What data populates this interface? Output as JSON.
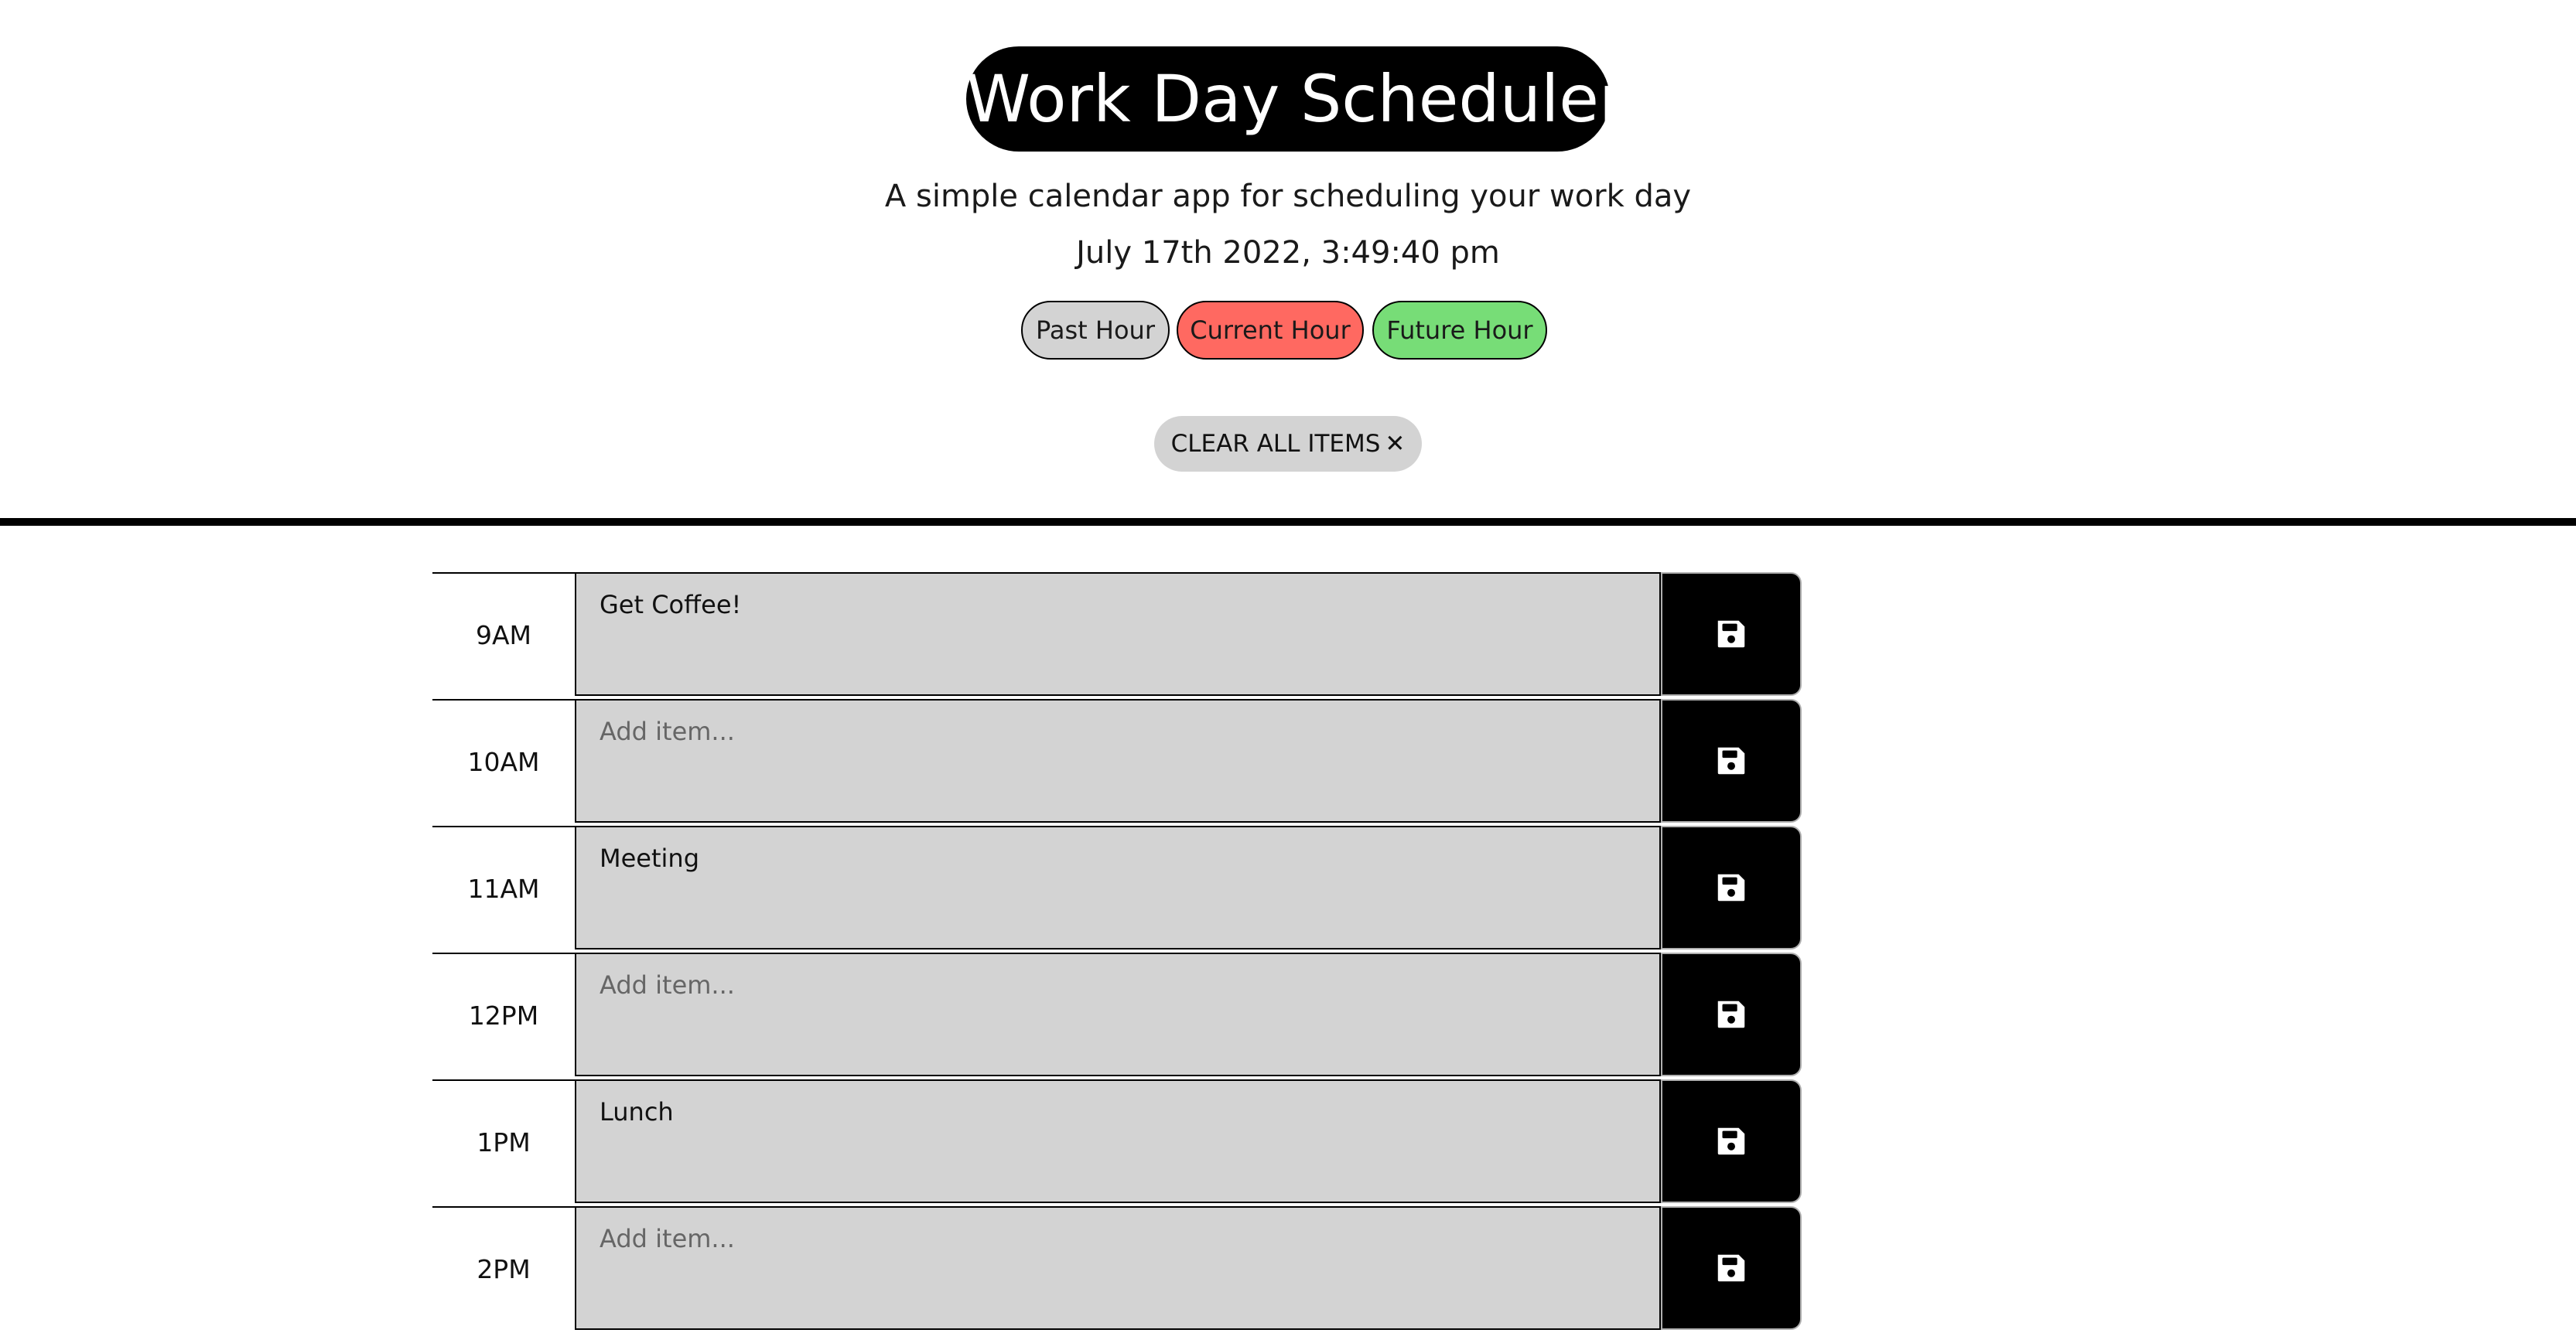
{
  "header": {
    "title": "Work Day Scheduler",
    "subtitle": "A simple calendar app for scheduling your work day",
    "datetime": "July 17th 2022, 3:49:40 pm"
  },
  "legend": {
    "past": "Past Hour",
    "current": "Current Hour",
    "future": "Future Hour"
  },
  "clear_button": {
    "label": "CLEAR ALL ITEMS",
    "icon": "✕"
  },
  "colors": {
    "past": "#d3d3d3",
    "current": "#ff6961",
    "future": "#77dd77",
    "save_button": "#000000"
  },
  "rows": [
    {
      "hour": "9AM",
      "value": "Get Coffee!",
      "placeholder": "Add item...",
      "save_icon": "floppy-disk-icon"
    },
    {
      "hour": "10AM",
      "value": "",
      "placeholder": "Add item...",
      "save_icon": "floppy-disk-icon"
    },
    {
      "hour": "11AM",
      "value": "Meeting",
      "placeholder": "Add item...",
      "save_icon": "floppy-disk-icon"
    },
    {
      "hour": "12PM",
      "value": "",
      "placeholder": "Add item...",
      "save_icon": "floppy-disk-icon"
    },
    {
      "hour": "1PM",
      "value": "Lunch",
      "placeholder": "Add item...",
      "save_icon": "floppy-disk-icon"
    },
    {
      "hour": "2PM",
      "value": "",
      "placeholder": "Add item...",
      "save_icon": "floppy-disk-icon"
    }
  ]
}
